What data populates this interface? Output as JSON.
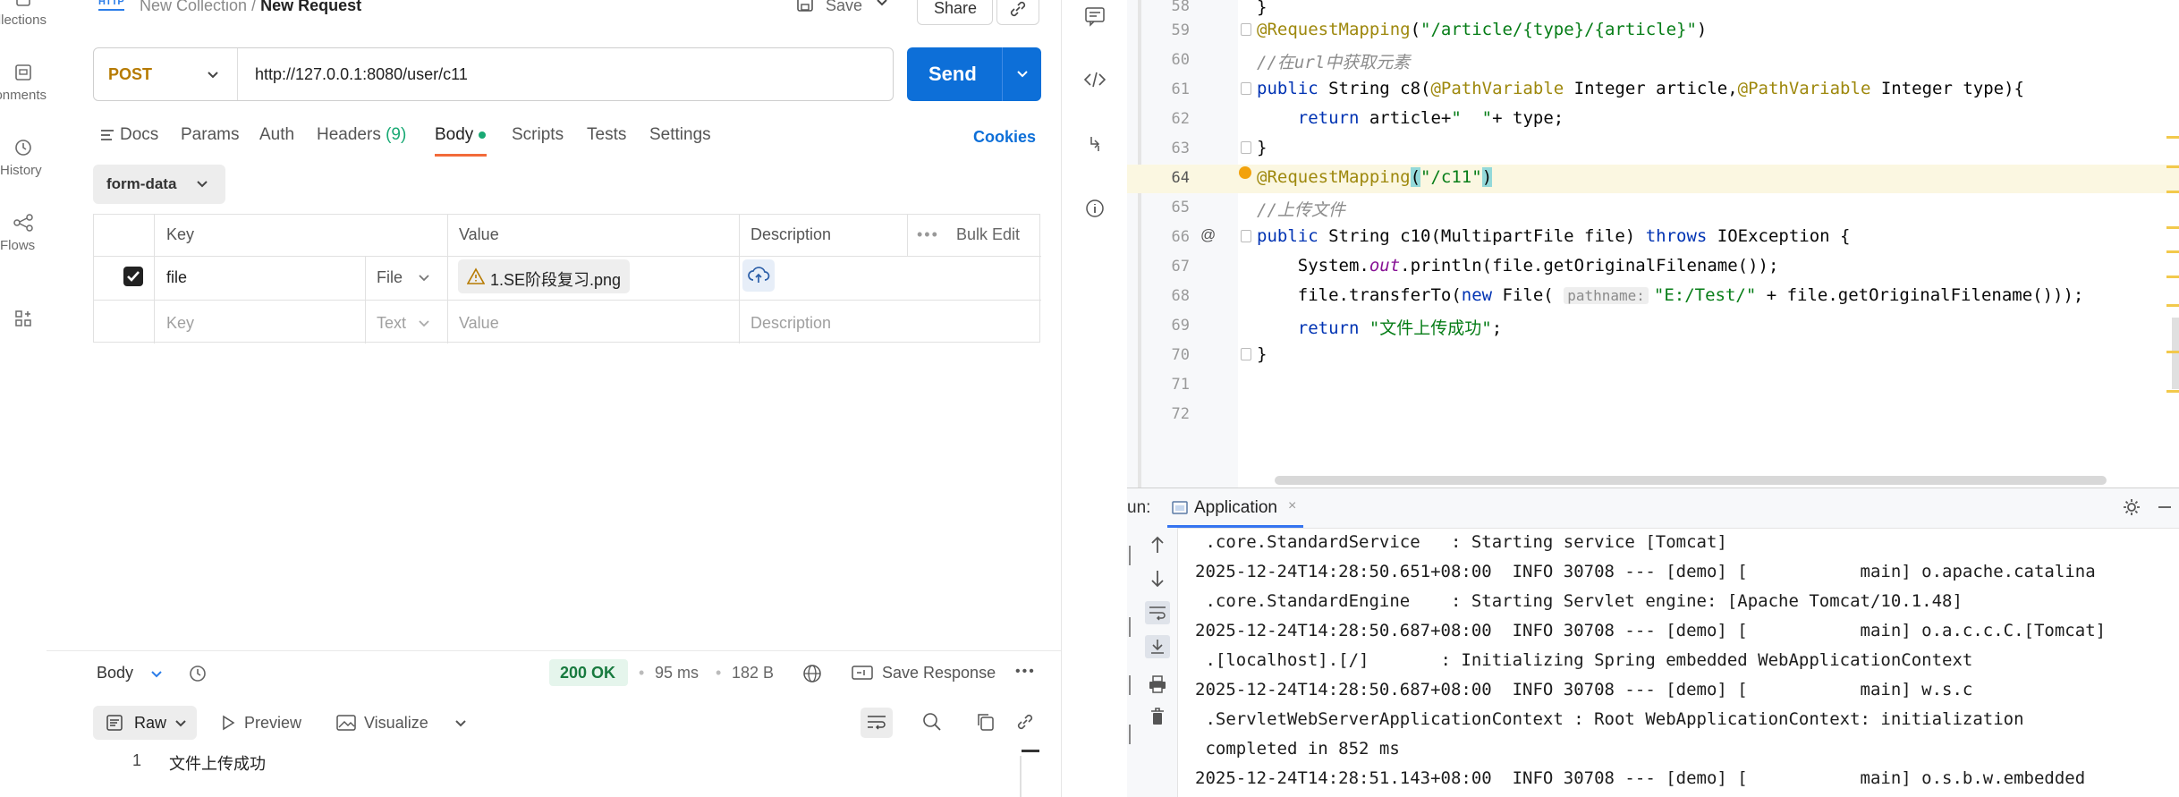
{
  "sidebar": {
    "items": [
      {
        "label": "Collections",
        "icon": "collections-icon"
      },
      {
        "label": "Environments",
        "icon": "environments-icon"
      },
      {
        "label": "History",
        "icon": "history-icon"
      },
      {
        "label": "Flows",
        "icon": "flows-icon"
      },
      {
        "label": "",
        "icon": "add-workspace-icon"
      }
    ]
  },
  "header": {
    "http_badge": "HTTP",
    "breadcrumb_collection": "New Collection",
    "breadcrumb_sep": "/",
    "request_name": "New Request",
    "save_label": "Save",
    "share_label": "Share"
  },
  "request": {
    "method": "POST",
    "url": "http://127.0.0.1:8080/user/c11",
    "send_label": "Send"
  },
  "tabs": [
    {
      "label": "Docs"
    },
    {
      "label": "Params"
    },
    {
      "label": "Auth"
    },
    {
      "label": "Headers",
      "count": "(9)"
    },
    {
      "label": "Body"
    },
    {
      "label": "Scripts"
    },
    {
      "label": "Tests"
    },
    {
      "label": "Settings"
    }
  ],
  "cookies_label": "Cookies",
  "body_mode": "form-data",
  "kv_table": {
    "headers": {
      "key": "Key",
      "value": "Value",
      "description": "Description",
      "bulk_edit": "Bulk Edit"
    },
    "rows": [
      {
        "checked": true,
        "key": "file",
        "type": "File",
        "value": "1.SE阶段复习.png",
        "description": ""
      }
    ],
    "placeholder": {
      "key": "Key",
      "type": "Text",
      "value": "Value",
      "description": "Description"
    }
  },
  "response": {
    "section_label": "Body",
    "status": "200 OK",
    "time": "95 ms",
    "size": "182 B",
    "save_response": "Save Response",
    "format": "Raw",
    "preview": "Preview",
    "visualize": "Visualize",
    "lines": [
      {
        "num": "1",
        "text": "文件上传成功"
      }
    ]
  },
  "editor": {
    "line_numbers": [
      "58",
      "59",
      "60",
      "61",
      "62",
      "63",
      "64",
      "65",
      "66",
      "67",
      "68",
      "69",
      "70",
      "71",
      "72"
    ],
    "current_line": "64",
    "hint_pathname": "pathname:"
  },
  "run_panel": {
    "label": "un:",
    "tab": "Application",
    "console_lines": [
      " .core.StandardService   : Starting service [Tomcat]",
      "2025-12-24T14:28:50.651+08:00  INFO 30708 --- [demo] [           main] o.apache.catalina",
      " .core.StandardEngine    : Starting Servlet engine: [Apache Tomcat/10.1.48]",
      "2025-12-24T14:28:50.687+08:00  INFO 30708 --- [demo] [           main] o.a.c.c.C.[Tomcat]",
      " .[localhost].[/]       : Initializing Spring embedded WebApplicationContext",
      "2025-12-24T14:28:50.687+08:00  INFO 30708 --- [demo] [           main] w.s.c",
      " .ServletWebServerApplicationContext : Root WebApplicationContext: initialization",
      " completed in 852 ms",
      "2025-12-24T14:28:51.143+08:00  INFO 30708 --- [demo] [           main] o.s.b.w.embedded"
    ]
  },
  "colors": {
    "send_blue": "#0d6fd8",
    "method_post": "#b67a00",
    "status_green": "#187a3f",
    "tab_underline": "#f26b3a"
  }
}
